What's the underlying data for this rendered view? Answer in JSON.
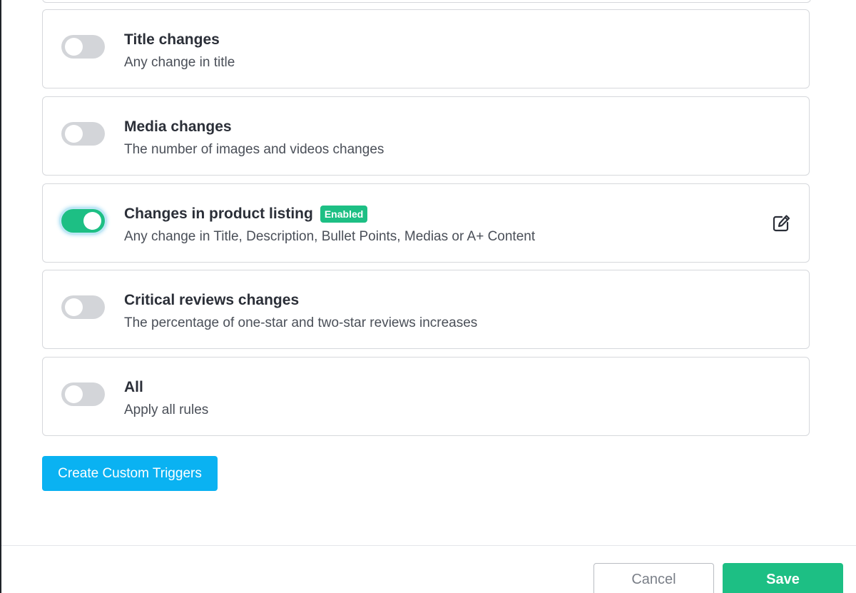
{
  "rules": [
    {
      "title": "Title changes",
      "description": "Any change in title",
      "enabled": false
    },
    {
      "title": "Media changes",
      "description": "The number of images and videos changes",
      "enabled": false
    },
    {
      "title": "Changes in product listing",
      "description": "Any change in Title, Description, Bullet Points, Medias or A+ Content",
      "enabled": true,
      "badge": "Enabled",
      "action_icon": "edit-icon"
    },
    {
      "title": "Critical reviews changes",
      "description": "The percentage of one-star and two-star reviews increases",
      "enabled": false
    },
    {
      "title": "All",
      "description": "Apply all rules",
      "enabled": false
    }
  ],
  "actions": {
    "create_custom_triggers_label": "Create Custom Triggers",
    "cancel_label": "Cancel",
    "save_label": "Save"
  },
  "colors": {
    "toggle_on": "#1dbf84",
    "toggle_off": "#d3d5d9",
    "badge": "#1dbf84",
    "primary_button": "#0ab2f2",
    "save_button": "#1dbf84",
    "card_border": "#d6d8dc"
  }
}
